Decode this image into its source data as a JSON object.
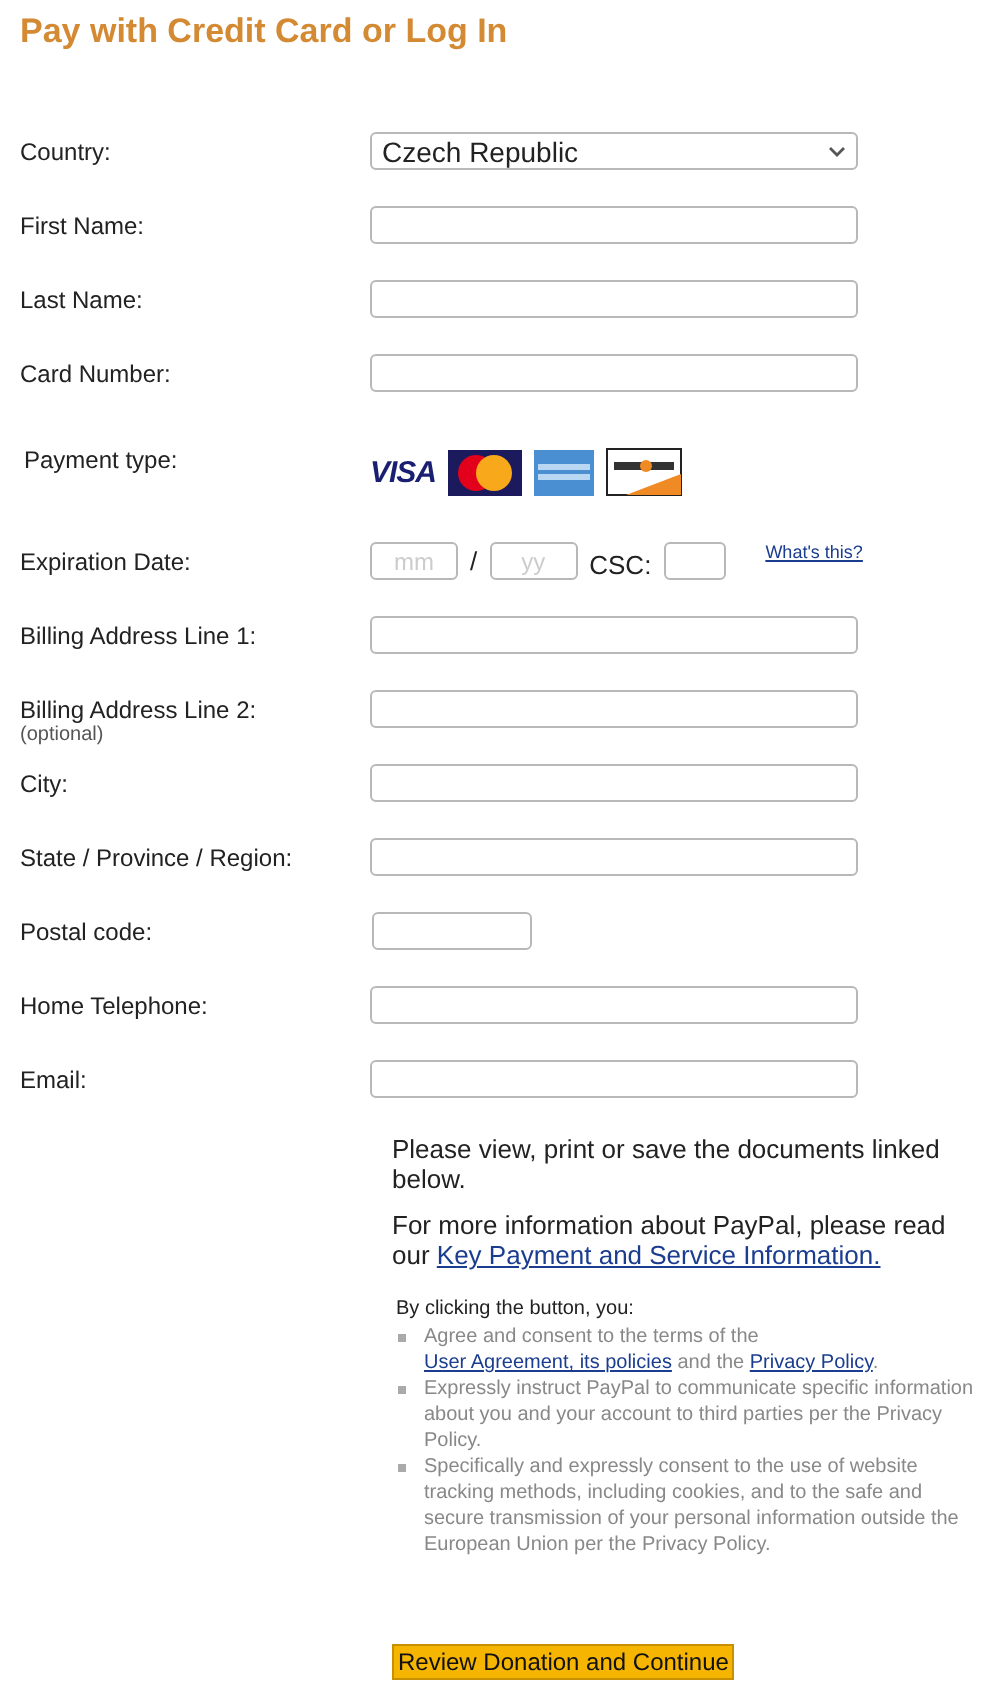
{
  "title": "Pay with Credit Card or Log In",
  "rows": [
    {
      "kind": "select",
      "label": "Country:",
      "value": "Czech Republic"
    },
    {
      "kind": "text",
      "label": "First Name:"
    },
    {
      "kind": "text",
      "label": "Last Name:"
    },
    {
      "kind": "text",
      "label": "Card Number:"
    },
    {
      "kind": "payment",
      "label": "Payment type:",
      "logos": [
        {
          "kind": "visa",
          "label": "VISA"
        },
        {
          "kind": "mastercard"
        },
        {
          "kind": "amex"
        },
        {
          "kind": "discover"
        }
      ]
    },
    {
      "kind": "expiry",
      "label": "Expiration Date:",
      "month_placeholder": "mm",
      "separator": "/",
      "year_placeholder": "yy",
      "csc_label": "CSC:",
      "help_link": "What's this?"
    },
    {
      "kind": "text",
      "label": "Billing Address Line 1:"
    },
    {
      "kind": "text",
      "label": "Billing Address Line 2:",
      "note": "(optional)"
    },
    {
      "kind": "text",
      "label": "City:"
    },
    {
      "kind": "text",
      "label": "State / Province / Region:"
    },
    {
      "kind": "short",
      "label": "Postal code:"
    },
    {
      "kind": "text",
      "label": "Home Telephone:"
    },
    {
      "kind": "text",
      "label": "Email:"
    }
  ],
  "notice": "Please view, print or save the documents linked below.",
  "info": [
    {
      "text": "For more information about PayPal, please read our "
    },
    {
      "link": "Key Payment and Service Information."
    }
  ],
  "consent_heading": "By clicking the button, you:",
  "consent_items": [
    [
      {
        "text": "Agree and consent to the terms of the "
      },
      {
        "link": "User Agreement, its policies"
      },
      {
        "text": " and the "
      },
      {
        "link": "Privacy Policy"
      },
      {
        "text": "."
      }
    ],
    [
      {
        "text": "Expressly instruct PayPal to communicate specific information about you and your account to third parties per the Privacy Policy."
      }
    ],
    [
      {
        "text": "Specifically and expressly consent to the use of website tracking methods, including cookies, and to the safe and secure transmission of your personal information outside the European Union per the Privacy Policy."
      }
    ]
  ],
  "button": "Review Donation and Continue"
}
